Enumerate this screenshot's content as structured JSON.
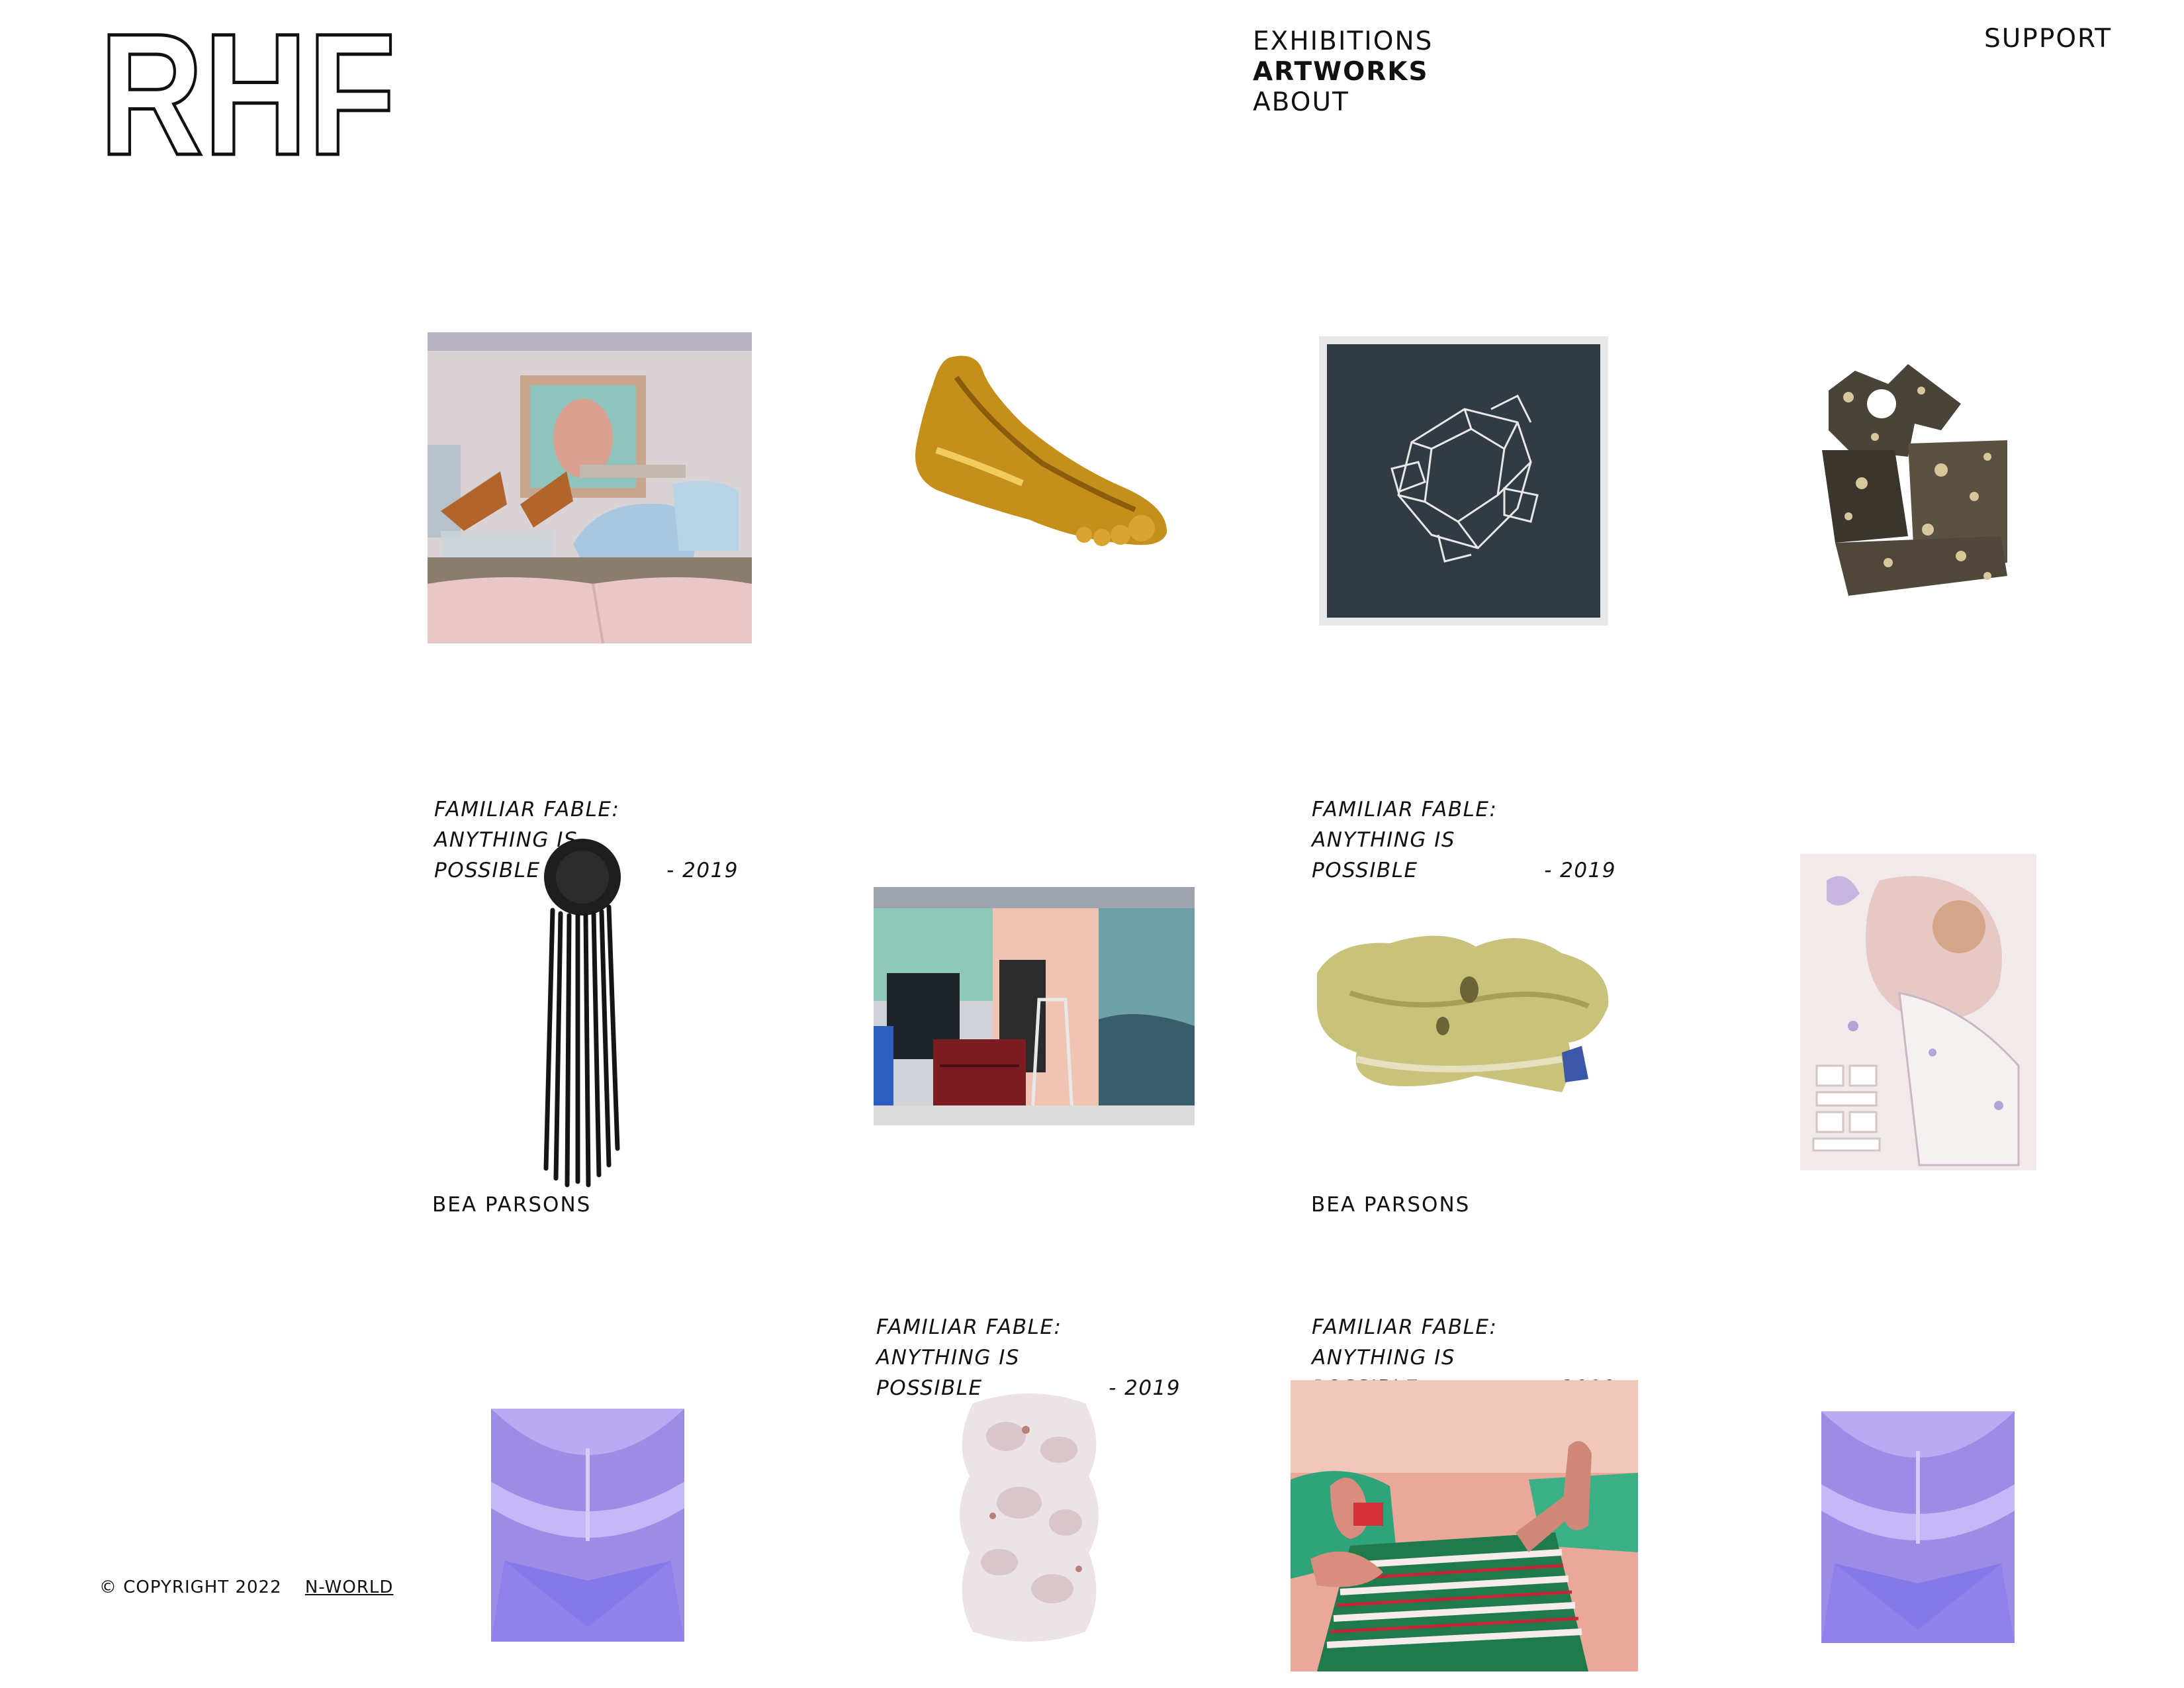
{
  "brand": {
    "logo_text": "RHF"
  },
  "nav": {
    "items": [
      "EXHIBITIONS",
      "ARTWORKS",
      "ABOUT"
    ],
    "active": "ARTWORKS"
  },
  "support": "SUPPORT",
  "footer": {
    "copyright": "© COPYRIGHT 2022",
    "link": "N-WORLD"
  },
  "captions": [
    {
      "title_line1": "FAMILIAR FABLE: ANYTHING IS",
      "title_line2": "POSSIBLE",
      "year": "- 2019",
      "artist": "BEA PARSONS"
    },
    {
      "title_line1": "FAMILIAR FABLE: ANYTHING IS",
      "title_line2": "POSSIBLE",
      "year": "- 2019",
      "artist": "BEA PARSONS"
    },
    {
      "title_line1": "FAMILIAR FABLE: ANYTHING IS",
      "title_line2": "POSSIBLE",
      "year": "- 2019"
    },
    {
      "title_line1": "FAMILIAR FABLE: ANYTHING IS",
      "title_line2": "POSSIBLE",
      "year": "- 2019"
    }
  ]
}
